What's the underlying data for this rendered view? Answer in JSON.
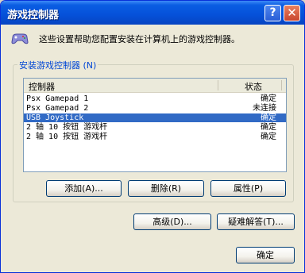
{
  "window": {
    "title": "游戏控制器",
    "help_glyph": "?",
    "close_glyph": "✕"
  },
  "description": "这些设置帮助您配置安装在计算机上的游戏控制器。",
  "group_label": "安装游戏控制器 (N)",
  "list": {
    "headers": {
      "controller": "控制器",
      "status": "状态"
    },
    "rows": [
      {
        "name": "Psx Gamepad 1",
        "status": "确定"
      },
      {
        "name": "Psx Gamepad 2",
        "status": "未连接"
      },
      {
        "name": "USB Joystick",
        "status": "确定"
      },
      {
        "name": "2 轴 10 按钮 游戏杆",
        "status": "确定"
      },
      {
        "name": "2 轴 10 按钮 游戏杆",
        "status": "确定"
      }
    ],
    "selected_index": 2
  },
  "buttons": {
    "add": "添加(A)...",
    "remove": "删除(R)",
    "properties": "属性(P)",
    "advanced": "高级(D)...",
    "troubleshoot": "疑难解答(T)...",
    "ok": "确定"
  },
  "icons": {
    "gamepad": "gamepad-icon"
  }
}
